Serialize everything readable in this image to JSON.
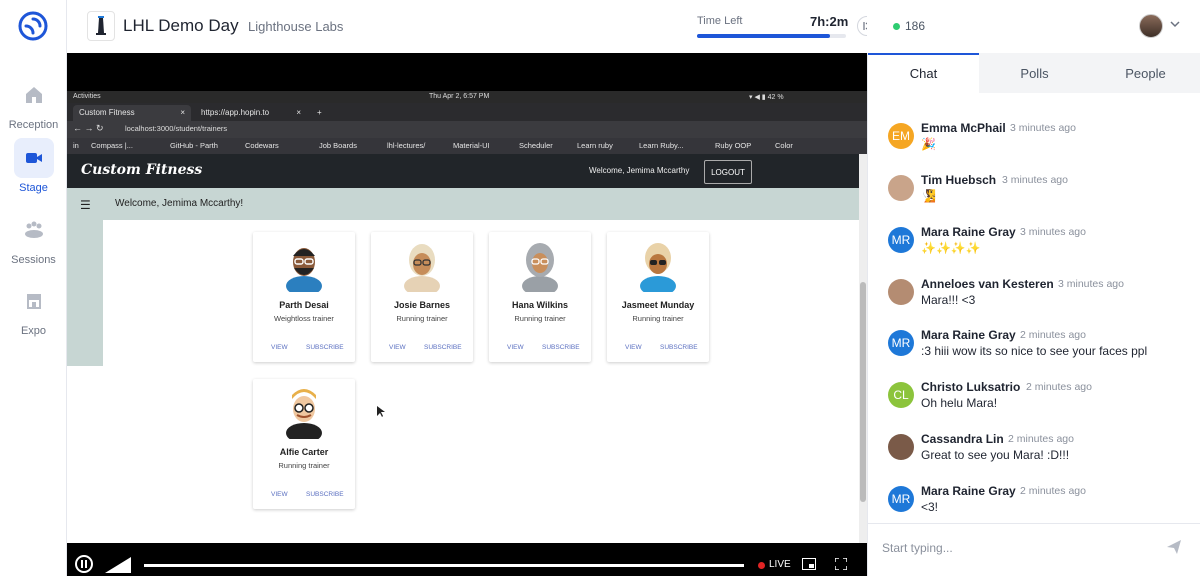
{
  "nav": {
    "items": [
      {
        "label": "Reception",
        "icon": "home-icon"
      },
      {
        "label": "Stage",
        "icon": "video-camera-icon",
        "active": true
      },
      {
        "label": "Sessions",
        "icon": "sessions-icon"
      },
      {
        "label": "Expo",
        "icon": "store-icon"
      }
    ]
  },
  "header": {
    "title": "LHL Demo Day",
    "organizer": "Lighthouse Labs",
    "time_left_label": "Time Left",
    "time_left_value": "7h:2m",
    "time_progress": 0.89
  },
  "top_right": {
    "online_count": "186"
  },
  "video": {
    "os_bar": {
      "activities": "Activities",
      "clock": "Thu Apr 2,  6:57 PM",
      "battery": "42 %"
    },
    "tabs": [
      {
        "label": "Custom Fitness"
      },
      {
        "label": "https://app.hopin.to"
      }
    ],
    "url": "localhost:3000/student/trainers",
    "bookmarks": [
      "in",
      "Compass |...",
      "GitHub - Parth",
      "Codewars",
      "Job Boards",
      "lhl-lectures/",
      "Material-UI",
      "Scheduler",
      "Learn ruby",
      "Learn Ruby...",
      "Ruby OOP",
      "Color"
    ],
    "site": {
      "brand": "Custom Fitness",
      "welcome_top": "Welcome, Jemima Mccarthy",
      "logout": "LOGOUT",
      "welcome_sub": "Welcome, Jemima Mccarthy!"
    },
    "trainers": [
      {
        "name": "Parth Desai",
        "role": "Weightloss trainer",
        "view": "VIEW",
        "subscribe": "SUBSCRIBE"
      },
      {
        "name": "Josie Barnes",
        "role": "Running trainer",
        "view": "VIEW",
        "subscribe": "SUBSCRIBE"
      },
      {
        "name": "Hana Wilkins",
        "role": "Running trainer",
        "view": "VIEW",
        "subscribe": "SUBSCRIBE"
      },
      {
        "name": "Jasmeet Munday",
        "role": "Running trainer",
        "view": "VIEW",
        "subscribe": "SUBSCRIBE"
      },
      {
        "name": "Alfie Carter",
        "role": "Running trainer",
        "view": "VIEW",
        "subscribe": "SUBSCRIBE"
      }
    ],
    "controls": {
      "live_label": "LIVE"
    }
  },
  "chat": {
    "tabs": [
      {
        "label": "Chat",
        "active": true
      },
      {
        "label": "Polls"
      },
      {
        "label": "People"
      }
    ],
    "messages": [
      {
        "initials": "EM",
        "color": "#f5a623",
        "name": "Emma McPhail",
        "time": "3 minutes ago",
        "text": "🎉"
      },
      {
        "initials": "",
        "color": "#c9a48a",
        "name": "Tim Huebsch",
        "time": "3 minutes ago",
        "text": "🧏"
      },
      {
        "initials": "MR",
        "color": "#1e78d8",
        "name": "Mara Raine Gray",
        "time": "3 minutes ago",
        "text": "✨✨✨✨"
      },
      {
        "initials": "",
        "color": "#b48c72",
        "name": "Anneloes van Kesteren",
        "time": "3 minutes ago",
        "text": "Mara!!! <3"
      },
      {
        "initials": "MR",
        "color": "#1e78d8",
        "name": "Mara Raine Gray",
        "time": "2 minutes ago",
        "text": ":3 hiii wow its so nice to see your faces ppl"
      },
      {
        "initials": "CL",
        "color": "#8cc43c",
        "name": "Christo Luksatrio",
        "time": "2 minutes ago",
        "text": "Oh helu Mara!"
      },
      {
        "initials": "",
        "color": "#7a5a48",
        "name": "Cassandra Lin",
        "time": "2 minutes ago",
        "text": "Great to see you Mara! :D!!!"
      },
      {
        "initials": "MR",
        "color": "#1e78d8",
        "name": "Mara Raine Gray",
        "time": "2 minutes ago",
        "text": "<3!"
      }
    ],
    "compose_placeholder": "Start typing..."
  }
}
